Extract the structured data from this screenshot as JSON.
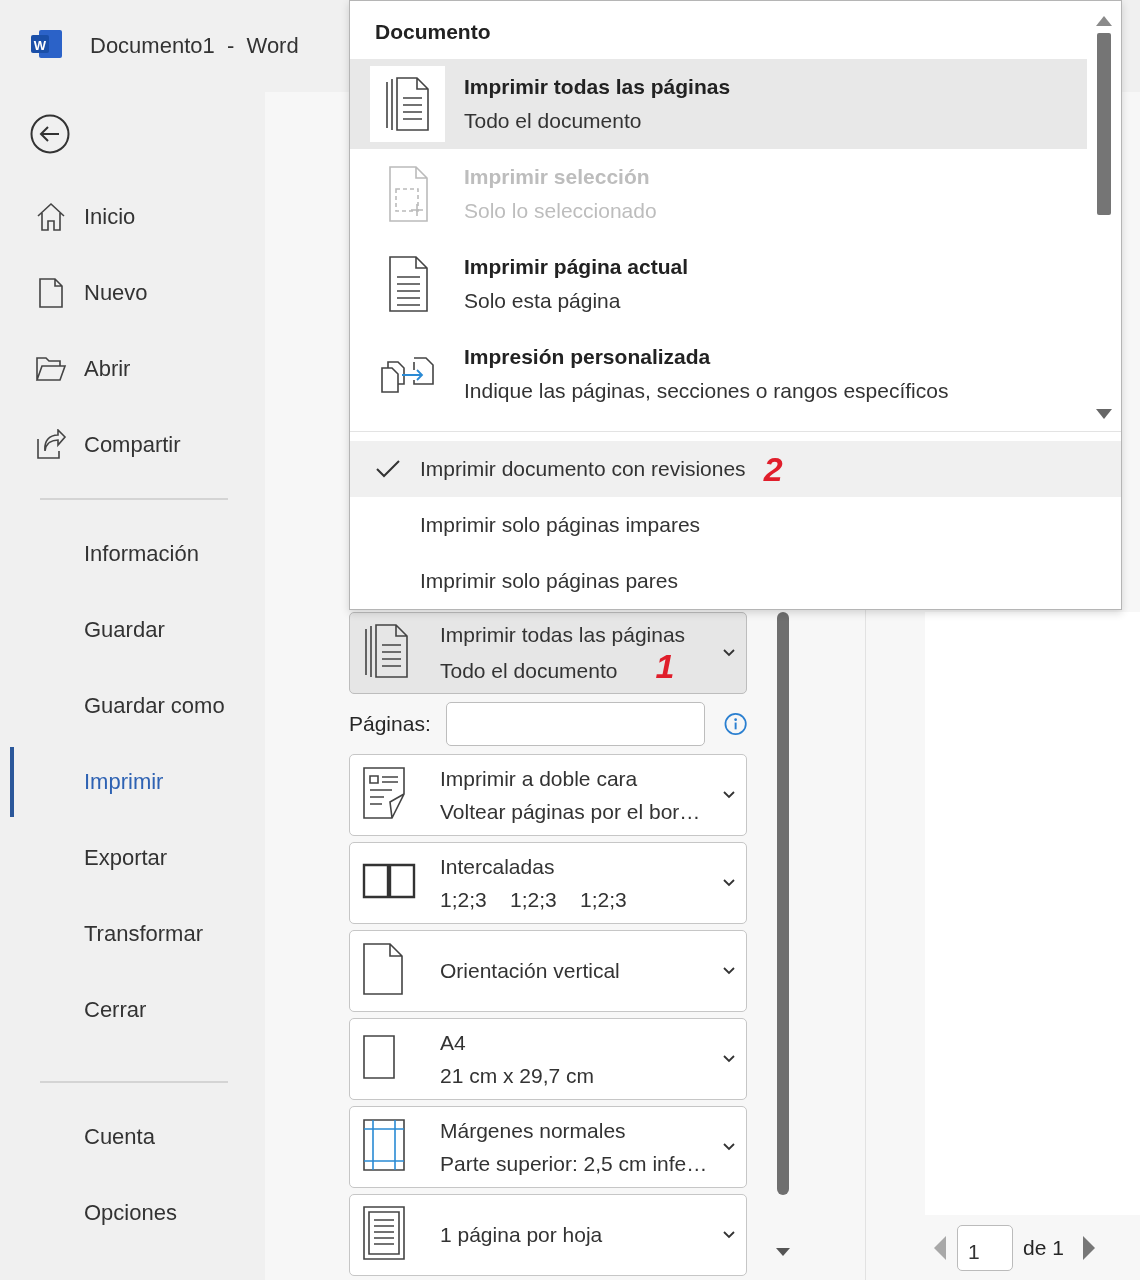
{
  "window": {
    "logo_letter": "W",
    "title": "Documento1  -  Word"
  },
  "sidebar": {
    "sections": [
      {
        "items": [
          {
            "label": "Inicio",
            "kind": "home",
            "selected": false
          },
          {
            "label": "Nuevo",
            "kind": "new",
            "selected": false
          },
          {
            "label": "Abrir",
            "kind": "open",
            "selected": false
          },
          {
            "label": "Compartir",
            "kind": "share",
            "selected": false
          }
        ]
      },
      {
        "items": [
          {
            "label": "Información",
            "selected": false
          },
          {
            "label": "Guardar",
            "selected": false
          },
          {
            "label": "Guardar como",
            "selected": false
          },
          {
            "label": "Imprimir",
            "selected": true
          },
          {
            "label": "Exportar",
            "selected": false
          },
          {
            "label": "Transformar",
            "selected": false
          },
          {
            "label": "Cerrar",
            "selected": false
          }
        ]
      },
      {
        "items": [
          {
            "label": "Cuenta",
            "selected": false
          },
          {
            "label": "Opciones",
            "selected": false
          }
        ]
      }
    ]
  },
  "print_settings": [
    {
      "kind": "pages",
      "title": "Imprimir todas las páginas",
      "subtitle": "Todo el documento",
      "selected": true,
      "annotation": "1"
    },
    {
      "kind": "field",
      "label": "Páginas:"
    },
    {
      "kind": "duplex",
      "title": "Imprimir a doble cara",
      "subtitle": "Voltear páginas por el bor…",
      "selected": false
    },
    {
      "kind": "collate",
      "title": "Intercaladas",
      "subtitle": "1;2;3    1;2;3    1;2;3",
      "selected": false
    },
    {
      "kind": "portrait",
      "title": "Orientación vertical",
      "selected": false
    },
    {
      "kind": "paper",
      "title": "A4",
      "subtitle": "21 cm x 29,7 cm",
      "selected": false
    },
    {
      "kind": "margins",
      "title": "Márgenes normales",
      "subtitle": "Parte superior: 2,5 cm infe…",
      "selected": false
    },
    {
      "kind": "sheet",
      "title": "1 página por hoja",
      "selected": false
    }
  ],
  "preview_nav": {
    "page": "1",
    "total": "de 1"
  },
  "dropdown_menu": {
    "header": "Documento",
    "items": [
      {
        "kind": "pages",
        "title": "Imprimir todas las páginas",
        "subtitle": "Todo el documento",
        "selected": true,
        "disabled": false
      },
      {
        "kind": "selection",
        "title": "Imprimir selección",
        "subtitle": "Solo lo seleccionado",
        "selected": false,
        "disabled": true
      },
      {
        "kind": "page",
        "title": "Imprimir página actual",
        "subtitle": "Solo esta página",
        "selected": false,
        "disabled": false
      },
      {
        "kind": "custom",
        "title": "Impresión personalizada",
        "subtitle": "Indique las páginas, secciones o rangos específicos",
        "selected": false,
        "disabled": false
      }
    ],
    "options": [
      {
        "label": "Imprimir documento con revisiones",
        "checked": true,
        "annotation": "2"
      },
      {
        "label": "Imprimir solo páginas impares",
        "checked": false
      },
      {
        "label": "Imprimir solo páginas pares",
        "checked": false
      }
    ]
  }
}
